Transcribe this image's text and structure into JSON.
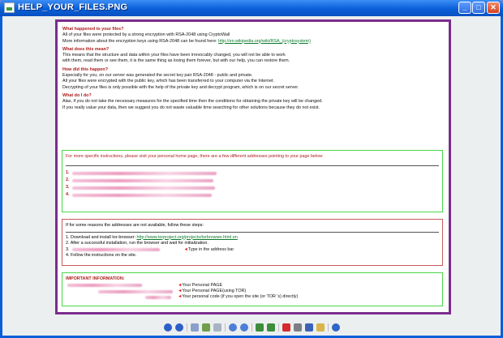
{
  "window": {
    "title": "HELP_YOUR_FILES.PNG",
    "controls": {
      "minimize": "_",
      "maximize": "□",
      "close": "✕"
    }
  },
  "document": {
    "sections": [
      {
        "heading": "What happened to your files?",
        "lines": [
          "All of your files were protected by a strong encryption with RSA-2048 using CryptoWall",
          "More information about the encryption keys using RSA-2048 can be found here:"
        ],
        "link": "http://en.wikipedia.org/wiki/RSA_(cryptosystem)"
      },
      {
        "heading": "What does this mean?",
        "lines": [
          "This means that the structure and data within your files have been irrevocably changed, you will not be able to work",
          "with them, read them or see them, it is the same thing as losing them forever, but with our help, you can restore them."
        ]
      },
      {
        "heading": "How did this happen?",
        "lines": [
          "Especially for you, on our server was generated the secret key pair RSA-2048 - public and private.",
          "All your files were encrypted with the public key, which has been transferred to your computer via the Internet.",
          "Decrypting of your files is only possible with the help of the private key and decrypt program, which is on our secret server."
        ]
      },
      {
        "heading": "What do I do?",
        "lines": [
          "Alas, if you do not take the necessary measures for the specified time then the conditions for obtaining the private key will be changed.",
          "If you really value your data, then we suggest you do not waste valuable time searching for other solutions because they do not exist."
        ]
      }
    ],
    "instructions_box": {
      "lead": "For more specific instructions, please visit your personal home page, there are a few different addresses pointing to your page below:",
      "numbers": [
        "1.",
        "2.",
        "3.",
        "4."
      ]
    },
    "tor_box": {
      "lead": "If for some reasons the addresses are not available, follow these steps:",
      "step1_prefix": "1. Download and install tor-browser:",
      "step1_link": "http://www.torproject.org/projects/torbrowser.html.en",
      "step2": "2. After a successful installation, run the browser and wait for initialization.",
      "step3_prefix": "3.",
      "step3_note": "Type in the address bar",
      "step4": "4. Follow the instructions on the site."
    },
    "important_box": {
      "heading": "IMPORTANT INFORMATION:",
      "notes": [
        "Your Personal PAGE",
        "Your Personal PAGE(using TOR)",
        "Your personal code (if you open the site (or TOR 's) directly)"
      ],
      "arrow": "◄"
    }
  },
  "toolbar": {
    "buttons": [
      "previous-image-icon",
      "next-image-icon",
      "best-fit-icon",
      "actual-size-icon",
      "zoom-in-icon",
      "zoom-out-icon",
      "rotate-clockwise-icon",
      "rotate-counterclockwise-icon",
      "delete-icon",
      "print-icon",
      "save-icon",
      "open-icon",
      "help-icon"
    ]
  }
}
